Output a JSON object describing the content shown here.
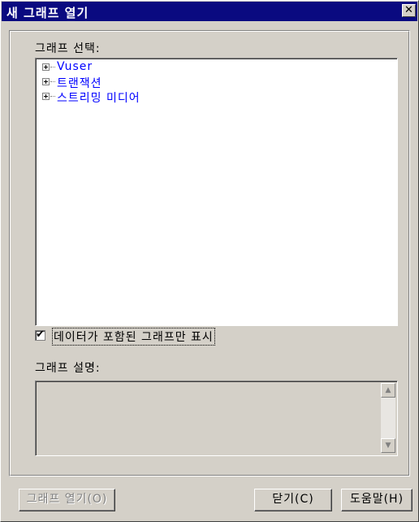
{
  "window": {
    "title": "새 그래프 열기",
    "close_glyph": "✕"
  },
  "select_section": {
    "label": "그래프 선택:"
  },
  "tree": {
    "items": [
      {
        "label": "Vuser",
        "expand_glyph": "+"
      },
      {
        "label": "트랜잭션",
        "expand_glyph": "+"
      },
      {
        "label": "스트리밍 미디어",
        "expand_glyph": "+"
      }
    ]
  },
  "filter_checkbox": {
    "label": "데이터가 포함된 그래프만 표시",
    "checked": true,
    "check_glyph": "✔"
  },
  "description": {
    "label": "그래프 설명:",
    "text": ""
  },
  "buttons": {
    "open": {
      "label": "그래프 열기(O)",
      "enabled": false
    },
    "close": {
      "label": "닫기(C)"
    },
    "help": {
      "label": "도움말(H)"
    }
  },
  "scroll": {
    "up_glyph": "▲",
    "down_glyph": "▼"
  }
}
